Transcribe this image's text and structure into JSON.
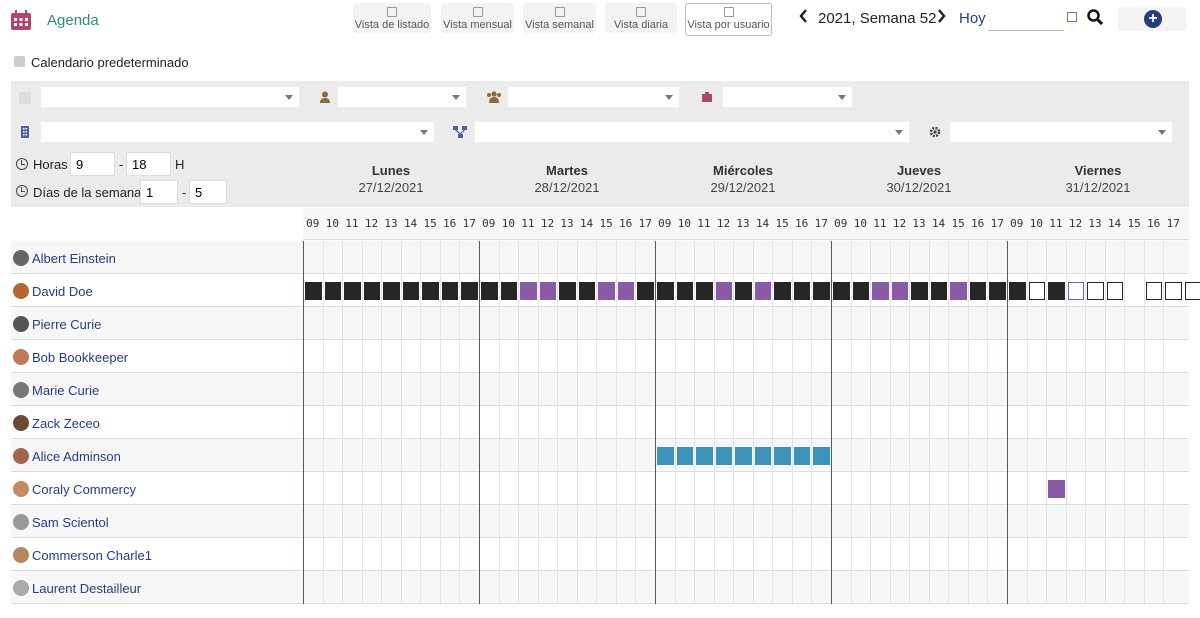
{
  "header": {
    "title": "Agenda",
    "views": [
      {
        "label": "Vista de listado",
        "icon": "list-icon"
      },
      {
        "label": "Vista mensual",
        "icon": "calendar-month-icon"
      },
      {
        "label": "Vista semanal",
        "icon": "calendar-week-icon"
      },
      {
        "label": "Vista diaria",
        "icon": "calendar-day-icon"
      },
      {
        "label": "Vista por usuario",
        "icon": "calendar-users-icon"
      }
    ],
    "active_view": "Vista por usuario",
    "period": "2021, Semana 52",
    "today": "Hoy",
    "date_value": ""
  },
  "default_calendar": {
    "label": "Calendario predeterminado",
    "checked": true
  },
  "filters": {
    "hours_label": "Horas",
    "hours_from": "9",
    "hours_to": "18",
    "hours_unit": "H",
    "days_label": "Días de la semana",
    "days_from": "1",
    "days_to": "5",
    "dash": "-"
  },
  "days": [
    {
      "name": "Lunes",
      "date": "27/12/2021"
    },
    {
      "name": "Martes",
      "date": "28/12/2021"
    },
    {
      "name": "Miércoles",
      "date": "29/12/2021"
    },
    {
      "name": "Jueves",
      "date": "30/12/2021"
    },
    {
      "name": "Viernes",
      "date": "31/12/2021"
    }
  ],
  "hours": [
    "09",
    "10",
    "11",
    "12",
    "13",
    "14",
    "15",
    "16",
    "17"
  ],
  "users": [
    {
      "name": "Albert Einstein",
      "avatar_color": "#666666",
      "events": ""
    },
    {
      "name": "David Doe",
      "avatar_color": "#b8662f",
      "events": "bbbbbbbbb|bbxxbbxxbxbb|bbbpbxbbbbb|bbppbbxbbbxbx|.obcoo.oooo"
    },
    {
      "name": "Pierre Curie",
      "avatar_color": "#555555",
      "events": ""
    },
    {
      "name": "Bob Bookkeeper",
      "avatar_color": "#c07a55",
      "events": ""
    },
    {
      "name": "Marie Curie",
      "avatar_color": "#777777",
      "events": ""
    },
    {
      "name": "Zack Zeceo",
      "avatar_color": "#6b4a35",
      "events": ""
    },
    {
      "name": "Alice Adminson",
      "avatar_color": "#a0654a",
      "events": "..|..|ttttttttt|..|.."
    },
    {
      "name": "Coraly Commercy",
      "avatar_color": "#c48a62",
      "events": "..|..|..|..|..p"
    },
    {
      "name": "Sam Scientol",
      "avatar_color": "#999999",
      "events": ""
    },
    {
      "name": "Commerson Charle1",
      "avatar_color": "#b58560",
      "events": ""
    },
    {
      "name": "Laurent Destailleur",
      "avatar_color": "#aaaaaa",
      "events": ""
    }
  ],
  "colors": {
    "accent": "#263c81",
    "title": "#2e8b82",
    "event_dark": "#262626",
    "event_purple": "#8a5aa5",
    "event_teal": "#3c93ba"
  }
}
